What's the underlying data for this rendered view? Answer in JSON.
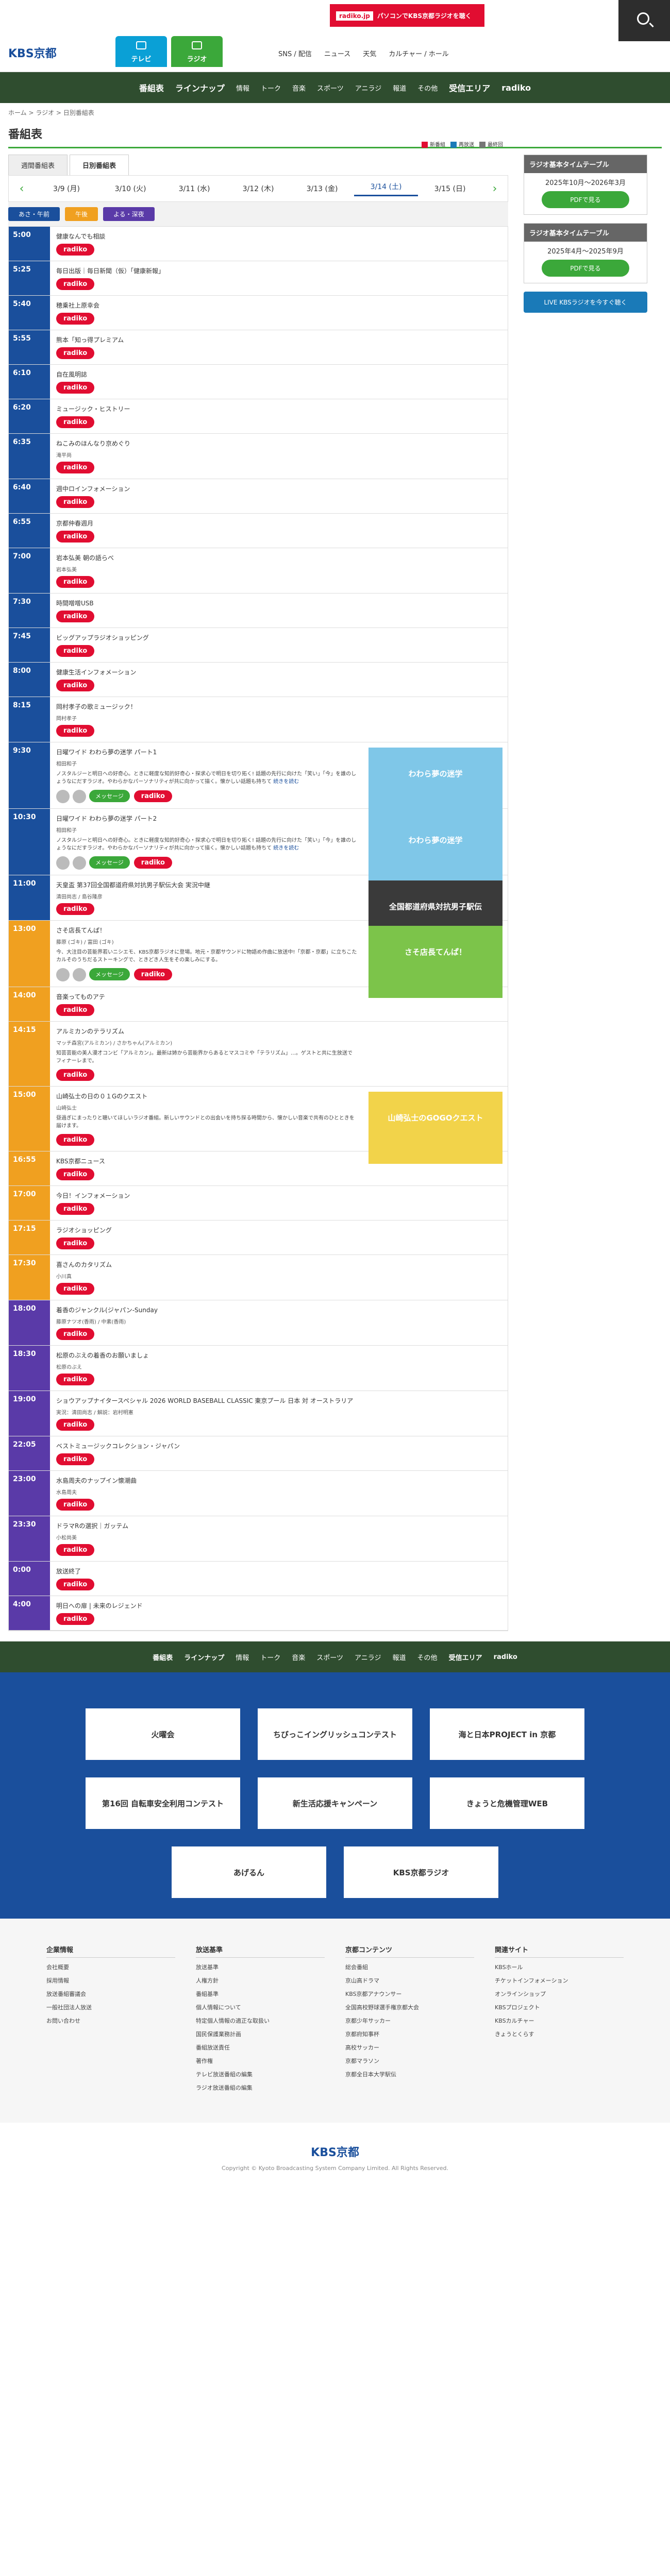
{
  "header": {
    "logo": "KBS京都",
    "tabs": [
      {
        "label": "テレビ",
        "color": "#0aa0d6"
      },
      {
        "label": "ラジオ",
        "color": "#3ba83a"
      }
    ],
    "radiko_banner": "radiko.jp",
    "radiko_banner_sub": "パソコンでKBS京都ラジオを聴く",
    "links": [
      "SNS / 配信",
      "ニュース",
      "天気",
      "カルチャー / ホール"
    ]
  },
  "nav": [
    "番組表",
    "ラインナップ",
    "情報",
    "トーク",
    "音楽",
    "スポーツ",
    "アニラジ",
    "報道",
    "その他",
    "受信エリア",
    "radiko"
  ],
  "breadcrumb": "ホーム > ラジオ > 日別番組表",
  "page_title": "番組表",
  "view_tabs": [
    "週間番組表",
    "日別番組表"
  ],
  "legend": [
    {
      "label": "新番組",
      "color": "#e10d31"
    },
    {
      "label": "再放送",
      "color": "#1a7ab8"
    },
    {
      "label": "最終回",
      "color": "#777"
    }
  ],
  "days": [
    "3/9 (月)",
    "3/10 (火)",
    "3/11 (水)",
    "3/12 (木)",
    "3/13 (金)",
    "3/14 (土)",
    "3/15 (日)"
  ],
  "selected_day": "3/14 (土)",
  "bands": [
    {
      "label": "あさ・午前",
      "color": "#1a4f9c"
    },
    {
      "label": "午後",
      "color": "#f0a020"
    },
    {
      "label": "よる・深夜",
      "color": "#5a3aa8"
    }
  ],
  "programs": [
    {
      "time": "5:00",
      "name": "健康なんでも相談",
      "color": "#1a4f9c"
    },
    {
      "time": "5:25",
      "name": "毎日出版｜毎日新聞（仮）「健康新報」",
      "color": "#1a4f9c"
    },
    {
      "time": "5:40",
      "name": "穂乗社上原幸会",
      "color": "#1a4f9c"
    },
    {
      "time": "5:55",
      "name": "熊本「知っ得プレミアム",
      "color": "#1a4f9c"
    },
    {
      "time": "6:10",
      "name": "自在風明誌",
      "color": "#1a4f9c"
    },
    {
      "time": "6:20",
      "name": "ミュージック・ヒストリー",
      "color": "#1a4f9c"
    },
    {
      "time": "6:35",
      "name": "ねこみのほんなり京めぐり",
      "cast": "滝平尚",
      "color": "#1a4f9c"
    },
    {
      "time": "6:40",
      "name": "週中ロインフォメーション",
      "color": "#1a4f9c"
    },
    {
      "time": "6:55",
      "name": "京都仲春週月",
      "color": "#1a4f9c"
    },
    {
      "time": "7:00",
      "name": "岩本弘美 朝の語らべ",
      "cast": "岩本弘美",
      "color": "#1a4f9c"
    },
    {
      "time": "7:30",
      "name": "時間噌噌USB",
      "color": "#1a4f9c"
    },
    {
      "time": "7:45",
      "name": "ビッグアップラジオショッピング",
      "color": "#1a4f9c"
    },
    {
      "time": "8:00",
      "name": "健康生活インフォメーション",
      "color": "#1a4f9c"
    },
    {
      "time": "8:15",
      "name": "岡村孝子の歌ミュージック！",
      "cast": "岡村孝子",
      "color": "#1a4f9c"
    },
    {
      "time": "9:30",
      "name": "日曜ワイド わわら夢の迷学 パート1",
      "cast": "相田和子",
      "desc": "ノスタルジーと明日への好奇心。ときに軽度な知的好奇心・探求心で明日を切り拓く! 話題の先行に向けた「笑い」「今」を誰のしょうなにだすラジオ。やわらかなパーソナリティが共に向かって描く。懐かしい話題も持ちて",
      "more": "続きを読む",
      "msg": "メッセージ",
      "img": "わわら夢の迷学",
      "img_color": "#7fc7e8",
      "color": "#1a4f9c"
    },
    {
      "time": "10:30",
      "name": "日曜ワイド わわら夢の迷学 パート2",
      "cast": "相田和子",
      "desc": "ノスタルジーと明日への好奇心。ときに軽度な知的好奇心・探求心で明日を切り拓く! 話題の先行に向けた「笑い」「今」を誰のしょうなにだすラジオ。やわらかなパーソナリティが共に向かって描く。懐かしい話題も持ちて",
      "more": "続きを読む",
      "msg": "メッセージ",
      "img": "わわら夢の迷学",
      "img_color": "#7fc7e8",
      "color": "#1a4f9c"
    },
    {
      "time": "11:00",
      "name": "天皇盃 第37回全国都道府県対抗男子駅伝大会 実況中継",
      "cast": "清田尚志 / 島谷隆彦",
      "img": "全国都道府県対抗男子駅伝",
      "img_color": "#3a3a3a",
      "color": "#1a4f9c"
    },
    {
      "time": "13:00",
      "name": "さそ店長てんぱ！",
      "cast": "藤原 (ゴキ) / 富田 (ゴキ)",
      "desc": "今、大注目の芸能界若いニシエモ、KBS京都ラジオに登場。地元・京都サウンドに物語め作曲に放送中!「京都・京都」に立ちこたカルそのうちだるストーキングで、ときどき人生をその楽しみにする。",
      "msg": "メッセージ",
      "img": "さそ店長てんぱ！",
      "img_color": "#7cc44a",
      "color": "#f0a020"
    },
    {
      "time": "14:00",
      "name": "音楽ってものアテ",
      "color": "#f0a020"
    },
    {
      "time": "14:15",
      "name": "アルミカンのテラリズム",
      "cast": "マッチ森宮(アルミカン) / さかちゃん(アルミカン)",
      "desc": "知芸芸能の美人漫才コンビ「アルミカン」。最新は姉から芸能界からあるとマスコミや「テラリズム」…。ゲストと共に生放送でフィナーレまで。",
      "color": "#f0a020"
    },
    {
      "time": "15:00",
      "name": "山崎弘士の日の０１Gのクエスト",
      "cast": "山崎弘士",
      "desc": "昼過ぎにまったりと聴いてほしいラジオ番組。新しいサウンドとの出会いを持ち探る時間から、懐かしい音楽で共有のひとときを届けます。",
      "img": "山崎弘士のGOGOクエスト",
      "img_color": "#f2d34a",
      "color": "#f0a020"
    },
    {
      "time": "16:55",
      "name": "KBS京都ニュース",
      "color": "#f0a020"
    },
    {
      "time": "17:00",
      "name": "今日！インフォメーション",
      "color": "#f0a020"
    },
    {
      "time": "17:15",
      "name": "ラジオショッピング",
      "color": "#f0a020"
    },
    {
      "time": "17:30",
      "name": "喜さんのカタリズム",
      "cast": "小川真",
      "color": "#f0a020"
    },
    {
      "time": "18:00",
      "name": "着香のジャンクル(ジャパン-Sunday",
      "cast": "藤原ナツオ(香雨) / 中素(香雨)",
      "color": "#5a3aa8"
    },
    {
      "time": "18:30",
      "name": "松原のぶえの着香のお願いましょ",
      "cast": "松原のぶえ",
      "color": "#5a3aa8"
    },
    {
      "time": "19:00",
      "name": "ショウアップナイタースペシャル 2026 WORLD BASEBALL CLASSIC 東京プール 日本 対 オーストラリア",
      "cast": "実況：清田尚志 / 解説：岩村明憲",
      "color": "#5a3aa8"
    },
    {
      "time": "22:05",
      "name": "ベストミュージックコレクション・ジャパン",
      "color": "#5a3aa8"
    },
    {
      "time": "23:00",
      "name": "水島周夫のナップイン懐潮曲",
      "cast": "水島周夫",
      "color": "#5a3aa8"
    },
    {
      "time": "23:30",
      "name": "ドラマRの選択｜ガッテム",
      "cast": "小松尚美",
      "color": "#5a3aa8"
    },
    {
      "time": "0:00",
      "name": "放送終了",
      "color": "#5a3aa8"
    },
    {
      "time": "4:00",
      "name": "明日への扉 | 未来のレジェンド",
      "color": "#5a3aa8"
    }
  ],
  "radiko_label": "radiko",
  "sidebar": {
    "box1": {
      "title": "ラジオ基本タイムテーブル",
      "period": "2025年10月〜2026年3月",
      "pdf": "PDFで見る"
    },
    "box2": {
      "title": "ラジオ基本タイムテーブル",
      "period": "2025年4月〜2025年9月",
      "pdf": "PDFで見る"
    },
    "live": "LIVE KBSラジオを今すぐ聴く"
  },
  "banners": [
    "火曜会",
    "ちびっこイングリッシュコンテスト",
    "海と日本PROJECT in 京都",
    "第16回 自転車安全利用コンテスト",
    "新生活応援キャンペーン",
    "きょうと危機管理WEB",
    "あげるん",
    "KBS京都ラジオ"
  ],
  "footer_links": [
    {
      "title": "企業情報",
      "items": [
        "会社概要",
        "採用情報",
        "放送番組審議会",
        "一般社団法人放送",
        "お問い合わせ"
      ]
    },
    {
      "title": "放送基準",
      "items": [
        "放送基準",
        "人権方針",
        "番組基準",
        "個人情報について",
        "特定個人情報の適正な取扱い",
        "国民保護業務計画",
        "番組放送責任",
        "著作権",
        "テレビ放送番組の編集",
        "ラジオ放送番組の編集"
      ]
    },
    {
      "title": "京都コンテンツ",
      "items": [
        "総会番組",
        "京山高ドラマ",
        "KBS京都アナウンサー",
        "全国高校野球選手権京都大会",
        "京都少年サッカー",
        "京都府知事杯",
        "高校サッカー",
        "京都マラソン",
        "京都全日本大学駅伝"
      ]
    },
    {
      "title": "関連サイト",
      "items": [
        "KBSホール",
        "チケットインフォメーション",
        "オンラインショップ",
        "KBSプロジェクト",
        "KBSカルチャー",
        "きょうとくらす"
      ]
    }
  ],
  "copyright": "Copyright © Kyoto Broadcasting System Company Limited. All Rights Reserved."
}
